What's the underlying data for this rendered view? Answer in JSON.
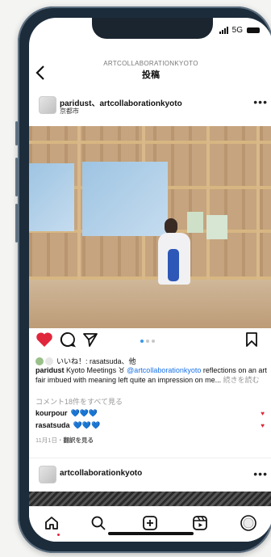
{
  "status": {
    "network": "5G"
  },
  "header": {
    "account": "ARTCOLLABORATIONKYOTO",
    "title": "投稿"
  },
  "post": {
    "users": "paridust、artcollaborationkyoto",
    "location": "京都市",
    "likes_text": "いいね！: rasatsuda、他",
    "caption_user": "paridust",
    "caption_text": "Kyoto Meetings ",
    "caption_icon": "♉",
    "caption_tag": "@artcollaborationkyoto",
    "caption_body": " reflections on an art fair imbued with meaning left quite an impression on me... ",
    "read_more": "続きを読む",
    "view_comments": "コメント18件をすべて見る",
    "comments": [
      {
        "user": "kourpour",
        "text": "💙💙💙"
      },
      {
        "user": "rasatsuda",
        "text": "💙💙💙"
      }
    ],
    "date": "11月1日・",
    "translate": "翻訳を見る"
  },
  "next_post": {
    "user": "artcollaborationkyoto"
  },
  "colors": {
    "like": "#e0263b",
    "link": "#1a73e8",
    "accent_dot": "#3897f0"
  },
  "icons": {
    "back": "chevron-left-icon",
    "more": "more-icon",
    "like": "heart-icon",
    "comment": "comment-icon",
    "share": "send-icon",
    "save": "bookmark-icon",
    "tabs": [
      "home-icon",
      "search-icon",
      "add-icon",
      "reels-icon",
      "profile-icon"
    ]
  }
}
